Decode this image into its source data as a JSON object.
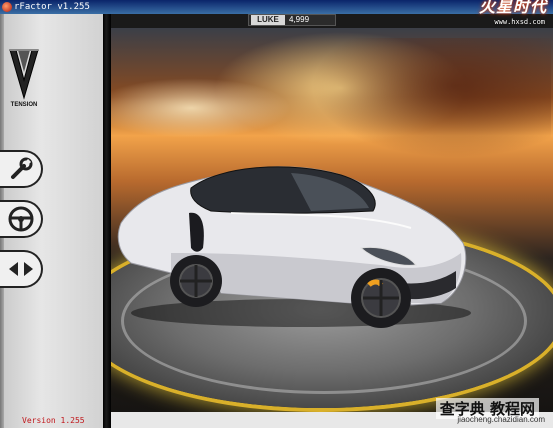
{
  "window": {
    "title": "rFactor v1.255"
  },
  "watermark_top": {
    "text": "火星时代",
    "url": "www.hxsd.com"
  },
  "header": {
    "user_name": "LUKE",
    "points": "4,999"
  },
  "sidebar": {
    "logo_caption": "TENSION",
    "buttons": [
      {
        "name": "setup",
        "icon": "wrench-icon"
      },
      {
        "name": "drive",
        "icon": "steering-wheel-icon"
      },
      {
        "name": "compare",
        "icon": "arrows-icon"
      }
    ],
    "version_label": "Version 1.255"
  },
  "watermark_bottom": {
    "text": "查字典 教程网",
    "url": "jiaocheng.chazidian.com"
  },
  "colors": {
    "titlebar": "#0a246a",
    "accent_ring": "#d9b02a",
    "version_text": "#c0161a"
  }
}
